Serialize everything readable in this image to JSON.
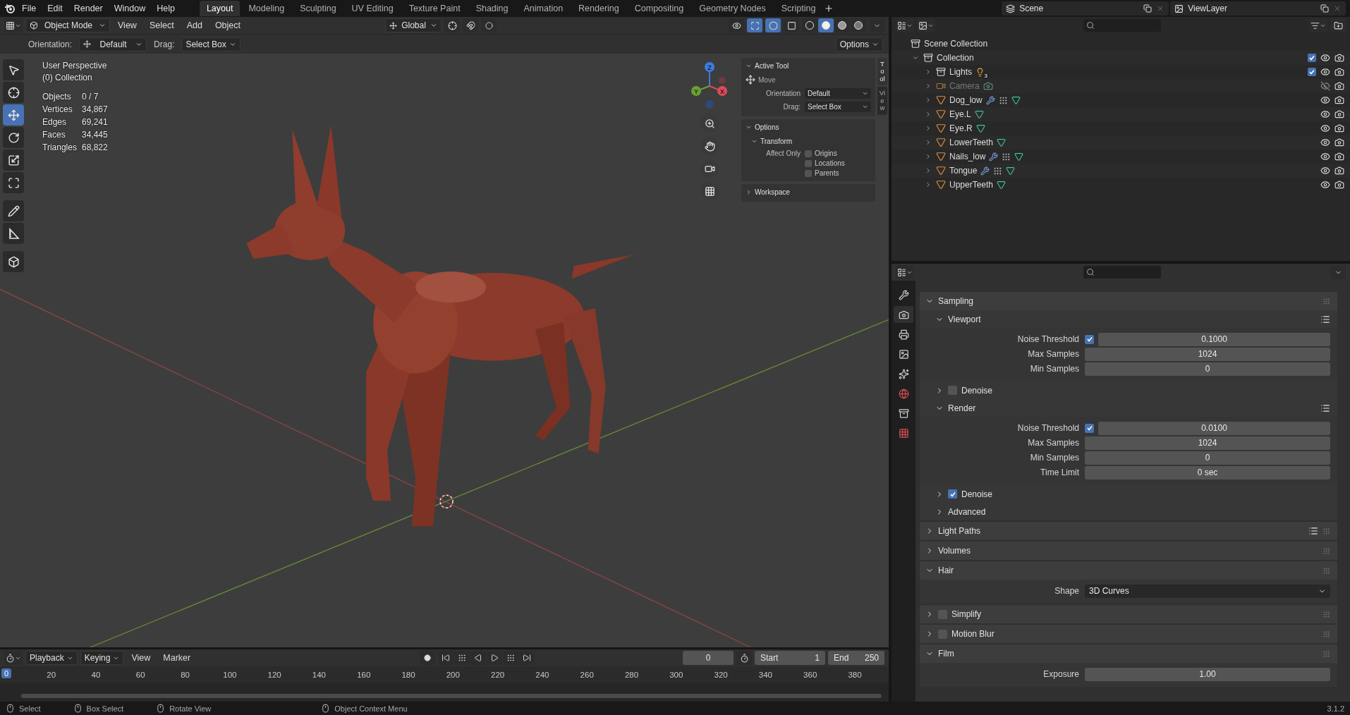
{
  "topbar": {
    "menus": [
      "File",
      "Edit",
      "Render",
      "Window",
      "Help"
    ],
    "workspaces": [
      {
        "label": "Layout",
        "selected": true
      },
      {
        "label": "Modeling",
        "selected": false
      },
      {
        "label": "Sculpting",
        "selected": false
      },
      {
        "label": "UV Editing",
        "selected": false
      },
      {
        "label": "Texture Paint",
        "selected": false
      },
      {
        "label": "Shading",
        "selected": false
      },
      {
        "label": "Animation",
        "selected": false
      },
      {
        "label": "Rendering",
        "selected": false
      },
      {
        "label": "Compositing",
        "selected": false
      },
      {
        "label": "Geometry Nodes",
        "selected": false
      },
      {
        "label": "Scripting",
        "selected": false
      }
    ],
    "scene": "Scene",
    "view_layer": "ViewLayer"
  },
  "viewport_header": {
    "mode": "Object Mode",
    "menus": [
      "View",
      "Select",
      "Add",
      "Object"
    ],
    "transform_orientation": "Global",
    "toggles": [
      {
        "kind": "gizmo",
        "on": true
      },
      {
        "kind": "overlay",
        "on": true
      },
      {
        "kind": "xray",
        "on": false
      }
    ],
    "shading_modes": [
      {
        "kind": "wireframe",
        "selected": false
      },
      {
        "kind": "solid",
        "selected": true
      },
      {
        "kind": "material",
        "selected": false
      },
      {
        "kind": "rendered",
        "selected": false
      }
    ]
  },
  "tool_settings": {
    "orientation_label": "Orientation:",
    "orientation": "Default",
    "drag_label": "Drag:",
    "drag": "Select Box",
    "options": "Options"
  },
  "viewport": {
    "view_name": "User Perspective",
    "collection": "(0) Collection",
    "stats": [
      {
        "label": "Objects",
        "value": "0 / 7"
      },
      {
        "label": "Vertices",
        "value": "34,867"
      },
      {
        "label": "Edges",
        "value": "69,241"
      },
      {
        "label": "Faces",
        "value": "34,445"
      },
      {
        "label": "Triangles",
        "value": "68,822"
      }
    ],
    "tools": [
      {
        "kind": "select",
        "selected": false
      },
      {
        "kind": "cursor",
        "selected": false
      },
      {
        "kind": "move",
        "selected": true
      },
      {
        "kind": "rotate",
        "selected": false
      },
      {
        "kind": "scale",
        "selected": false
      },
      {
        "kind": "transform",
        "selected": false
      },
      {
        "kind": "annotate",
        "selected": false
      },
      {
        "kind": "measure",
        "selected": false
      },
      {
        "kind": "add_cube",
        "selected": false
      }
    ],
    "gizmo": {
      "z": "Z",
      "y": "Y",
      "x": "X"
    }
  },
  "sidebar": {
    "tabs": [
      {
        "label": "Tool",
        "selected": true
      },
      {
        "label": "View",
        "selected": false
      }
    ],
    "active_tool": {
      "title": "Active Tool",
      "tool": "Move",
      "orientation_label": "Orientation",
      "orientation": "Default",
      "drag_label": "Drag:",
      "drag": "Select Box"
    },
    "options": {
      "title": "Options",
      "subtitle": "Transform",
      "affect_label": "Affect Only",
      "checkboxes": [
        {
          "label": "Origins",
          "checked": false
        },
        {
          "label": "Locations",
          "checked": false
        },
        {
          "label": "Parents",
          "checked": false
        }
      ]
    },
    "workspace": {
      "title": "Workspace",
      "expanded": false
    }
  },
  "outliner": {
    "root": {
      "name": "Scene Collection",
      "kind": "scene_collection",
      "children": [
        {
          "name": "Collection",
          "kind": "collection",
          "expanded": true,
          "checked": true,
          "visible": true,
          "children": [
            {
              "name": "Lights",
              "kind": "collection",
              "expanded": false,
              "checked": true,
              "visible": true,
              "dimmed": false,
              "badges": [
                {
                  "kind": "light",
                  "count": "3"
                }
              ]
            },
            {
              "name": "Camera",
              "kind": "camera",
              "expanded": false,
              "visible": false,
              "dimmed": true,
              "badges": [
                {
                  "kind": "camera_data"
                }
              ]
            },
            {
              "name": "Dog_low",
              "kind": "mesh",
              "expanded": false,
              "visible": true,
              "dimmed": false,
              "badges": [
                {
                  "kind": "modifier"
                },
                {
                  "kind": "dots"
                },
                {
                  "kind": "mesh_data"
                }
              ]
            },
            {
              "name": "Eye.L",
              "kind": "mesh",
              "expanded": false,
              "visible": true,
              "dimmed": false,
              "badges": [
                {
                  "kind": "mesh_data"
                }
              ]
            },
            {
              "name": "Eye.R",
              "kind": "mesh",
              "expanded": false,
              "visible": true,
              "dimmed": false,
              "badges": [
                {
                  "kind": "mesh_data"
                }
              ]
            },
            {
              "name": "LowerTeeth",
              "kind": "mesh",
              "expanded": false,
              "visible": true,
              "dimmed": false,
              "badges": [
                {
                  "kind": "mesh_data"
                }
              ]
            },
            {
              "name": "Nails_low",
              "kind": "mesh",
              "expanded": false,
              "visible": true,
              "dimmed": false,
              "badges": [
                {
                  "kind": "modifier"
                },
                {
                  "kind": "dots"
                },
                {
                  "kind": "mesh_data"
                }
              ]
            },
            {
              "name": "Tongue",
              "kind": "mesh",
              "expanded": false,
              "visible": true,
              "dimmed": false,
              "badges": [
                {
                  "kind": "modifier"
                },
                {
                  "kind": "dots"
                },
                {
                  "kind": "mesh_data"
                }
              ]
            },
            {
              "name": "UpperTeeth",
              "kind": "mesh",
              "expanded": false,
              "visible": true,
              "dimmed": false,
              "badges": [
                {
                  "kind": "mesh_data"
                }
              ]
            }
          ]
        }
      ]
    }
  },
  "properties": {
    "tabs": [
      {
        "kind": "tool",
        "selected": false
      },
      {
        "kind": "render",
        "selected": true
      },
      {
        "kind": "output",
        "selected": false
      },
      {
        "kind": "view_layer",
        "selected": false
      },
      {
        "kind": "scene",
        "selected": false
      },
      {
        "kind": "world",
        "selected": false
      },
      {
        "kind": "collection",
        "selected": false
      },
      {
        "kind": "texture",
        "selected": false
      }
    ],
    "panels": [
      {
        "title": "Sampling",
        "expanded": true,
        "children": [
          {
            "title": "Viewport",
            "expanded": true,
            "list_icon": true,
            "rows": [
              {
                "label": "Noise Threshold",
                "kind": "number",
                "checked": true,
                "value": "0.1000"
              },
              {
                "label": "Max Samples",
                "kind": "number",
                "value": "1024"
              },
              {
                "label": "Min Samples",
                "kind": "number",
                "value": "0"
              }
            ]
          },
          {
            "title": "Denoise",
            "expanded": false,
            "checked": false
          },
          {
            "title": "Render",
            "expanded": true,
            "list_icon": true,
            "rows": [
              {
                "label": "Noise Threshold",
                "kind": "number",
                "checked": true,
                "value": "0.0100"
              },
              {
                "label": "Max Samples",
                "kind": "number",
                "value": "1024"
              },
              {
                "label": "Min Samples",
                "kind": "number",
                "value": "0"
              },
              {
                "label": "Time Limit",
                "kind": "number",
                "value": "0 sec"
              }
            ]
          },
          {
            "title": "Denoise",
            "expanded": false,
            "checked": true
          },
          {
            "title": "Advanced",
            "expanded": false
          }
        ]
      },
      {
        "title": "Light Paths",
        "expanded": false,
        "list_icon": true
      },
      {
        "title": "Volumes",
        "expanded": false
      },
      {
        "title": "Hair",
        "expanded": true,
        "rows": [
          {
            "label": "Shape",
            "kind": "dropdown",
            "value": "3D Curves"
          }
        ]
      },
      {
        "title": "Simplify",
        "expanded": false,
        "checked": false
      },
      {
        "title": "Motion Blur",
        "expanded": false,
        "checked": false
      },
      {
        "title": "Film",
        "expanded": true,
        "rows": [
          {
            "label": "Exposure",
            "kind": "number",
            "value": "1.00"
          }
        ]
      }
    ]
  },
  "timeline": {
    "menus": [
      "Playback",
      "Keying",
      "View",
      "Marker"
    ],
    "current_frame": "0",
    "start_label": "Start",
    "start": "1",
    "end_label": "End",
    "end": "250",
    "playhead": "0",
    "ticks": [
      "20",
      "40",
      "60",
      "80",
      "100",
      "120",
      "140",
      "160",
      "180",
      "200",
      "220",
      "240",
      "260",
      "280",
      "300",
      "320",
      "340",
      "360",
      "380"
    ]
  },
  "status_bar": {
    "hints": [
      "Select",
      "Box Select",
      "Rotate View",
      "Object Context Menu"
    ],
    "version": "3.1.2"
  }
}
